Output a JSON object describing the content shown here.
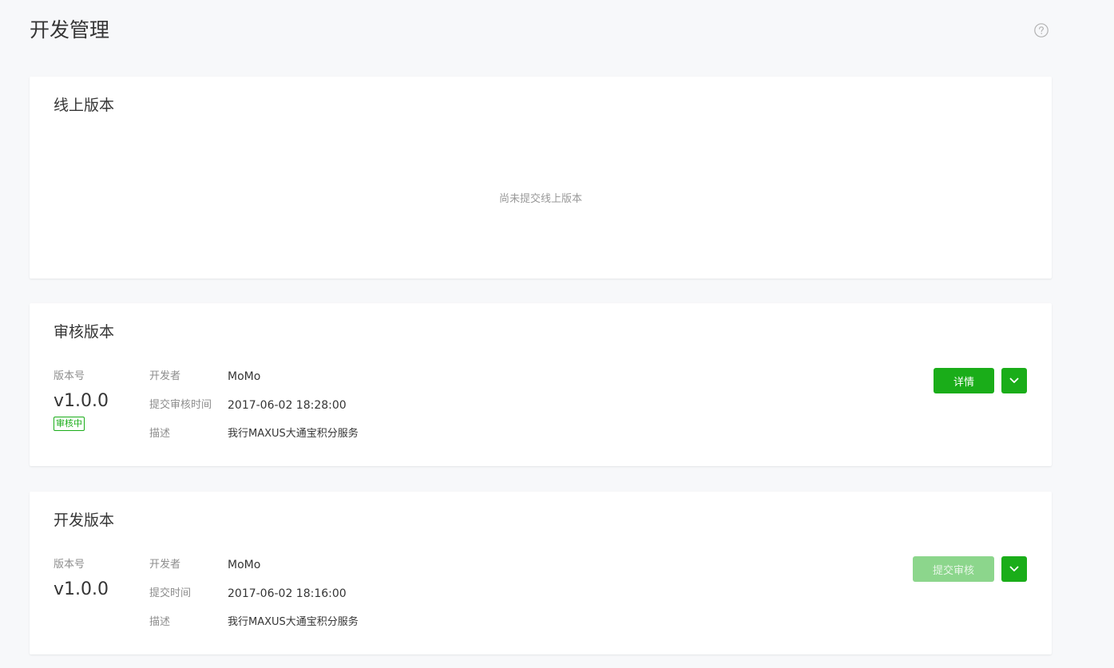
{
  "page": {
    "title": "开发管理"
  },
  "icons": {
    "help": "question-circle-icon",
    "dropdown": "chevron-down-icon"
  },
  "colors": {
    "accent": "#1aad19",
    "accent_disabled": "#8cd68c",
    "background": "#f7f8fa"
  },
  "online": {
    "title": "线上版本",
    "empty_text": "尚未提交线上版本"
  },
  "review": {
    "title": "审核版本",
    "version_label": "版本号",
    "version": "v1.0.0",
    "status": "审核中",
    "developer_label": "开发者",
    "developer": "MoMo",
    "time_label": "提交审核时间",
    "time": "2017-06-02 18:28:00",
    "desc_label": "描述",
    "desc": "我行MAXUS大通宝积分服务",
    "detail_button": "详情"
  },
  "dev": {
    "title": "开发版本",
    "version_label": "版本号",
    "version": "v1.0.0",
    "developer_label": "开发者",
    "developer": "MoMo",
    "time_label": "提交时间",
    "time": "2017-06-02 18:16:00",
    "desc_label": "描述",
    "desc": "我行MAXUS大通宝积分服务",
    "submit_button": "提交审核"
  }
}
